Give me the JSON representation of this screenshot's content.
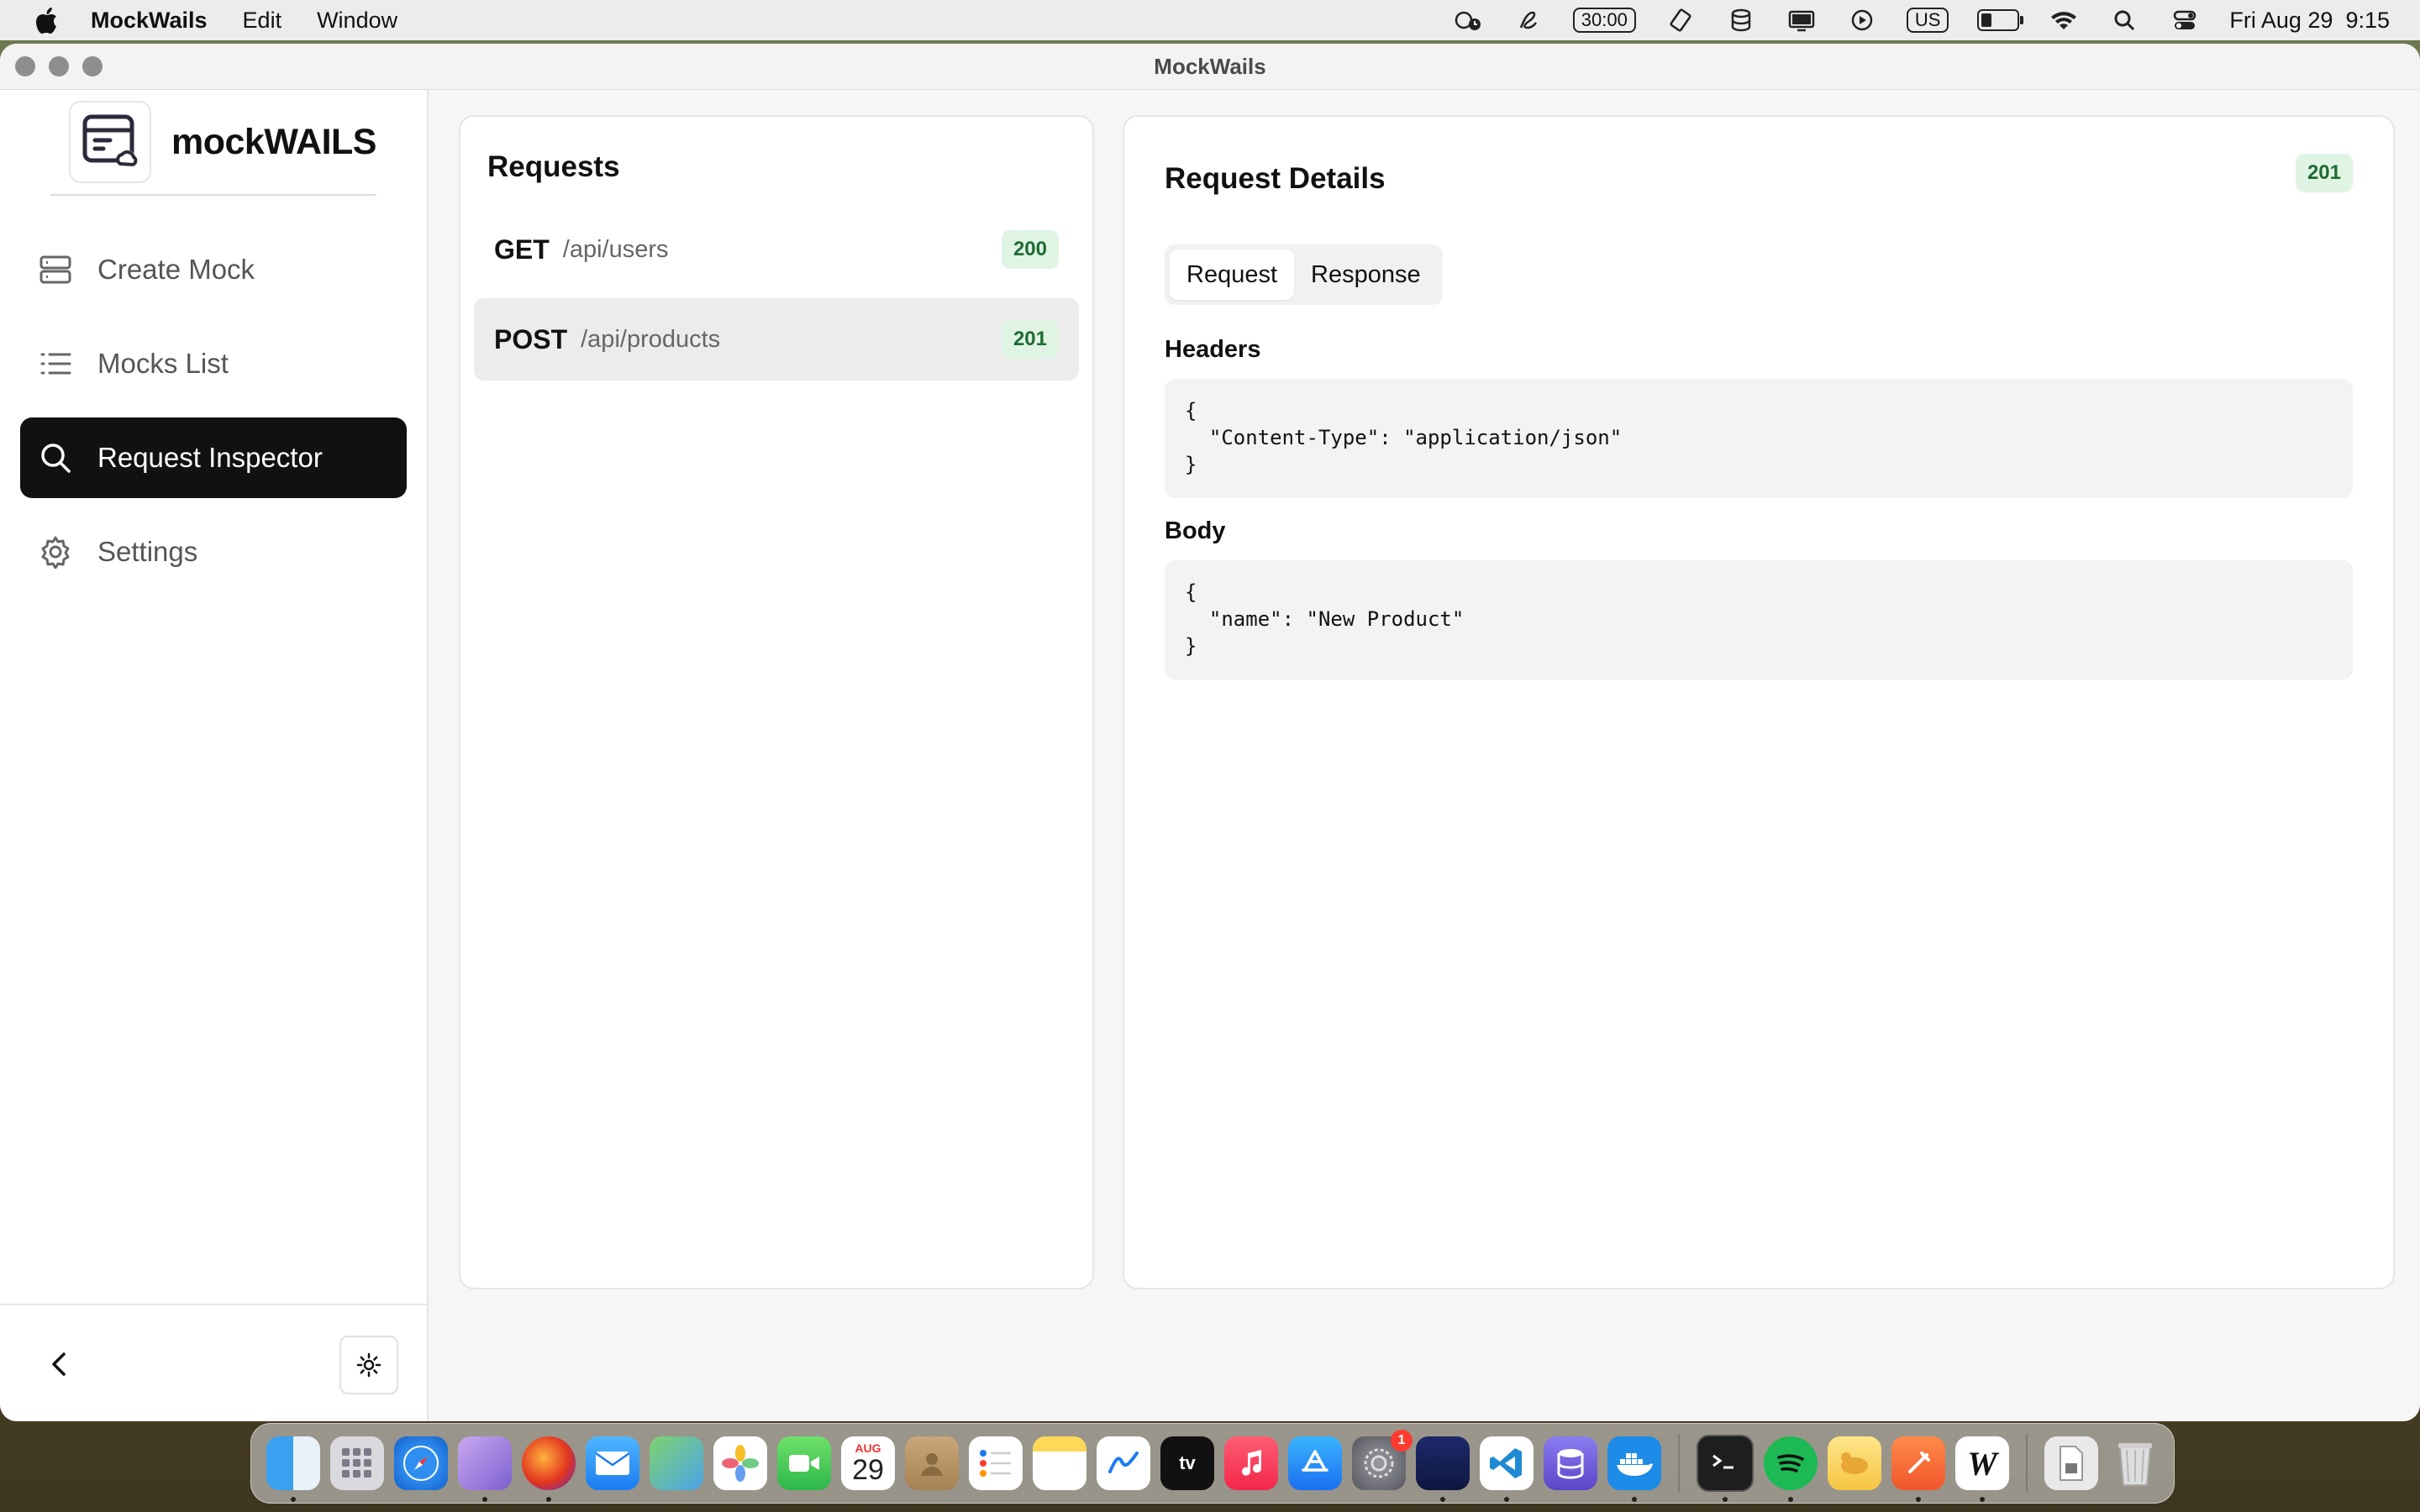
{
  "menubar": {
    "app_name": "MockWails",
    "items": [
      "Edit",
      "Window"
    ],
    "timer": "30:00",
    "keyboard": "US",
    "clock": "Fri Aug 29  9:15"
  },
  "window": {
    "title": "MockWails"
  },
  "sidebar": {
    "brand": "mockWAILS",
    "items": [
      {
        "label": "Create Mock",
        "icon": "server-stack-icon"
      },
      {
        "label": "Mocks List",
        "icon": "list-icon"
      },
      {
        "label": "Request Inspector",
        "icon": "search-icon",
        "active": true
      },
      {
        "label": "Settings",
        "icon": "gear-icon"
      }
    ]
  },
  "requests": {
    "title": "Requests",
    "rows": [
      {
        "method": "GET",
        "path": "/api/users",
        "status": "200"
      },
      {
        "method": "POST",
        "path": "/api/products",
        "status": "201",
        "selected": true
      }
    ]
  },
  "details": {
    "title": "Request Details",
    "status": "201",
    "tabs": [
      "Request",
      "Response"
    ],
    "active_tab": "Request",
    "headers_label": "Headers",
    "headers_code": "{\n  \"Content-Type\": \"application/json\"\n}",
    "body_label": "Body",
    "body_code": "{\n  \"name\": \"New Product\"\n}"
  },
  "dock": {
    "calendar_month": "AUG",
    "calendar_day": "29",
    "notification_badge": "1"
  },
  "colors": {
    "active_nav": "#111111",
    "badge_bg": "#dff4e3",
    "badge_text": "#1f6b33"
  }
}
